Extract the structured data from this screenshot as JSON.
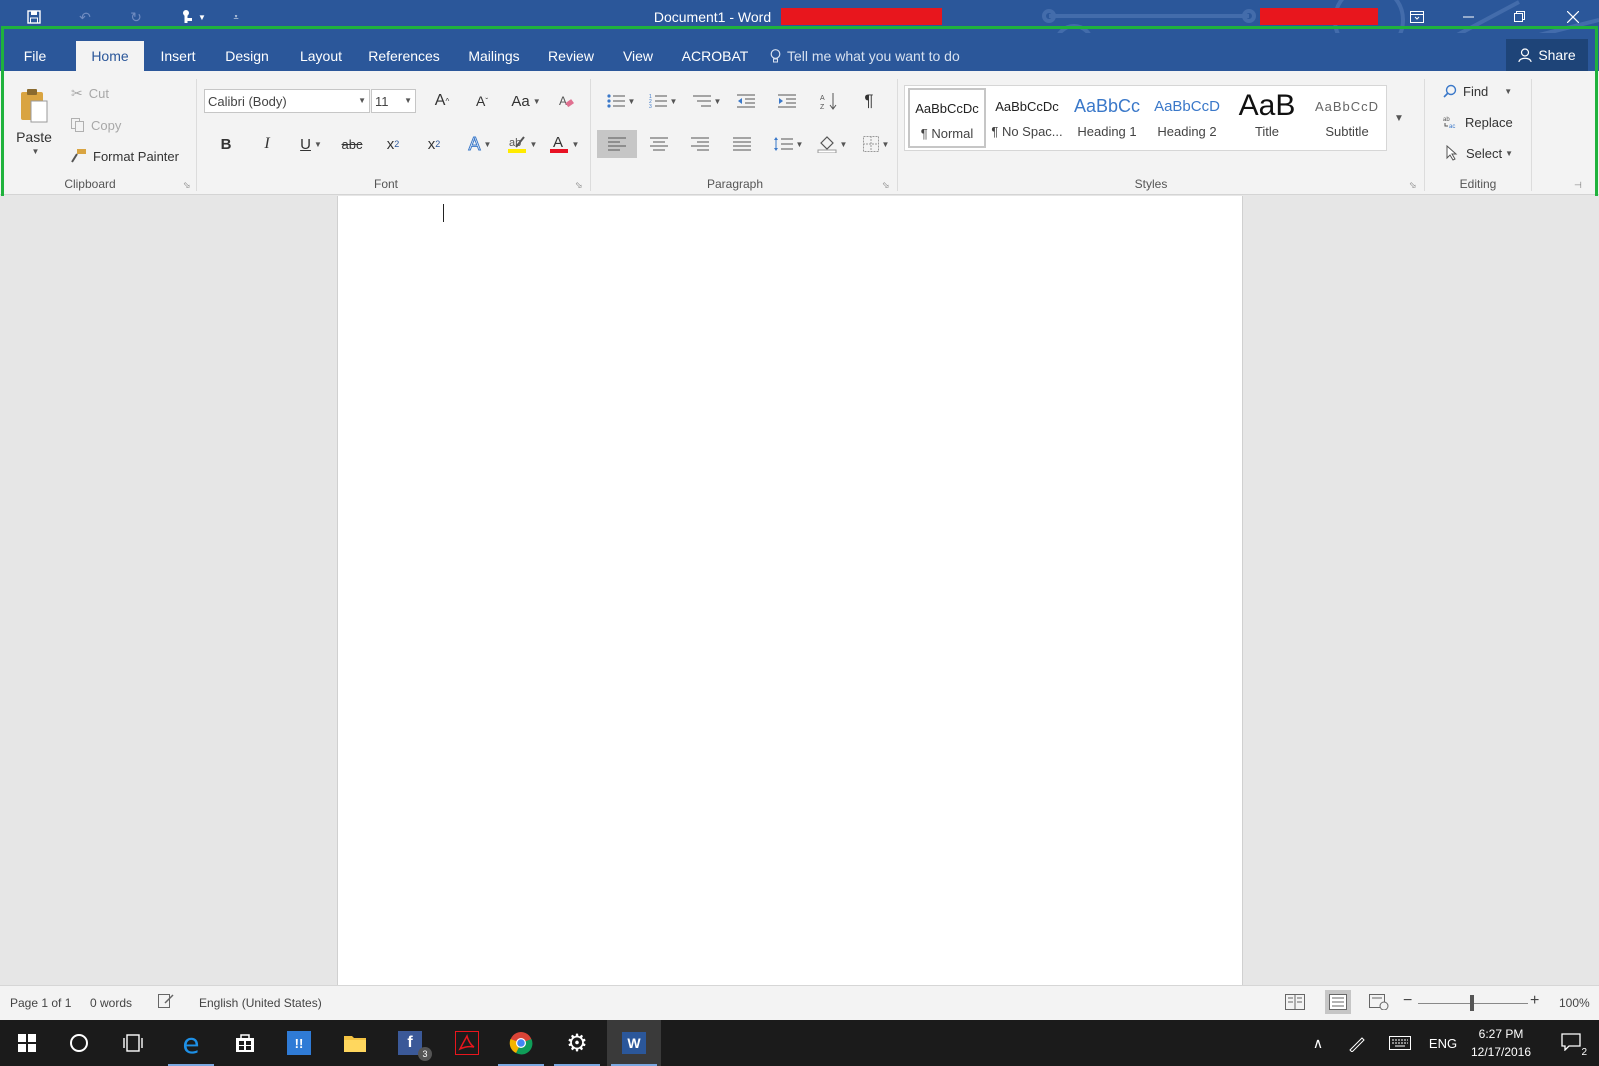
{
  "window": {
    "title": "Document1  -  Word"
  },
  "tabs": [
    "File",
    "Home",
    "Insert",
    "Design",
    "Layout",
    "References",
    "Mailings",
    "Review",
    "View",
    "ACROBAT"
  ],
  "active_tab": "Home",
  "tell_me": "Tell me what you want to do",
  "share_label": "Share",
  "clipboard": {
    "paste": "Paste",
    "cut": "Cut",
    "copy": "Copy",
    "format_painter": "Format Painter",
    "group_label": "Clipboard"
  },
  "font": {
    "font_name": "Calibri (Body)",
    "font_size": "11",
    "grow": "A",
    "shrink": "A",
    "change_case": "Aa",
    "bold": "B",
    "italic": "I",
    "underline": "U",
    "strikethrough": "abc",
    "subscript_base": "x",
    "subscript_mark": "2",
    "superscript_base": "x",
    "superscript_mark": "2",
    "group_label": "Font"
  },
  "paragraph": {
    "group_label": "Paragraph"
  },
  "styles": {
    "items": [
      {
        "preview": "AaBbCcDc",
        "name": "¶ Normal"
      },
      {
        "preview": "AaBbCcDc",
        "name": "¶ No Spac..."
      },
      {
        "preview": "AaBbCc",
        "name": "Heading 1"
      },
      {
        "preview": "AaBbCcD",
        "name": "Heading 2"
      },
      {
        "preview": "AaB",
        "name": "Title"
      },
      {
        "preview": "AaBbCcD",
        "name": "Subtitle"
      }
    ],
    "group_label": "Styles"
  },
  "editing": {
    "find": "Find",
    "replace": "Replace",
    "select": "Select",
    "group_label": "Editing"
  },
  "status": {
    "page": "Page 1 of 1",
    "words": "0 words",
    "language": "English (United States)",
    "zoom": "100%"
  },
  "taskbar": {
    "language": "ENG",
    "time": "6:27 PM",
    "date": "12/17/2016",
    "notification_count": "2",
    "facebook_badge": "3"
  },
  "colors": {
    "word_blue": "#2b579a",
    "highlight_green": "#1fb23c",
    "redaction_red": "#e8161d"
  }
}
